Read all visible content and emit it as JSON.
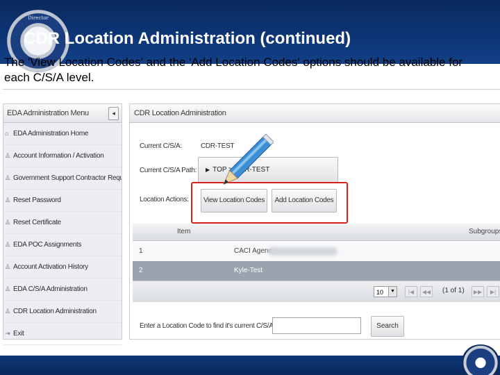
{
  "slide": {
    "title": "CDR Location Administration (continued)",
    "subtitle": "The 'View Location Codes' and the 'Add Location Codes' options should be available for each C/S/A level.",
    "seal_text": "Director"
  },
  "sidebar": {
    "title": "EDA Administration Menu",
    "collapse_glyph": "◂",
    "items": [
      {
        "label": "EDA Administration Home",
        "icon": "home-icon"
      },
      {
        "label": "Account Information / Activation",
        "icon": "user-icon"
      },
      {
        "label": "Government Support Contractor Request",
        "icon": "user-icon"
      },
      {
        "label": "Reset Password",
        "icon": "user-icon"
      },
      {
        "label": "Reset Certificate",
        "icon": "user-icon"
      },
      {
        "label": "EDA POC Assignments",
        "icon": "user-icon"
      },
      {
        "label": "Account Activation History",
        "icon": "user-icon"
      },
      {
        "label": "EDA C/S/A Administration",
        "icon": "user-icon"
      },
      {
        "label": "CDR Location Administration",
        "icon": "user-icon"
      },
      {
        "label": "Exit",
        "icon": "exit-icon"
      }
    ]
  },
  "panel": {
    "title": "CDR Location Administration",
    "current_csa_label": "Current C/S/A:",
    "current_csa_value": "CDR-TEST",
    "current_path_label": "Current C/S/A Path:",
    "current_path_value": "TOP > CDR-TEST",
    "location_actions_label": "Location Actions:",
    "view_button": "View Location Codes",
    "add_button": "Add Location Codes",
    "table": {
      "columns": [
        "Item",
        "Subgroups"
      ],
      "rows": [
        {
          "item": "1",
          "subgroup": "CACI Agency"
        },
        {
          "item": "2",
          "subgroup": "Kyle-Test"
        }
      ]
    },
    "pager": {
      "page_size": "10",
      "info": "(1 of 1)",
      "first_glyph": "|◀",
      "prev_glyph": "◀◀",
      "next_glyph": "▶▶",
      "last_glyph": "▶|",
      "dropdown_glyph": "▼"
    },
    "search_label": "Enter a Location Code to find it's current C/S/A:",
    "search_button": "Search"
  },
  "colors": {
    "header_blue": "#0d3575",
    "highlight_red": "#d62020",
    "pencil_blue": "#3d8fd8"
  }
}
